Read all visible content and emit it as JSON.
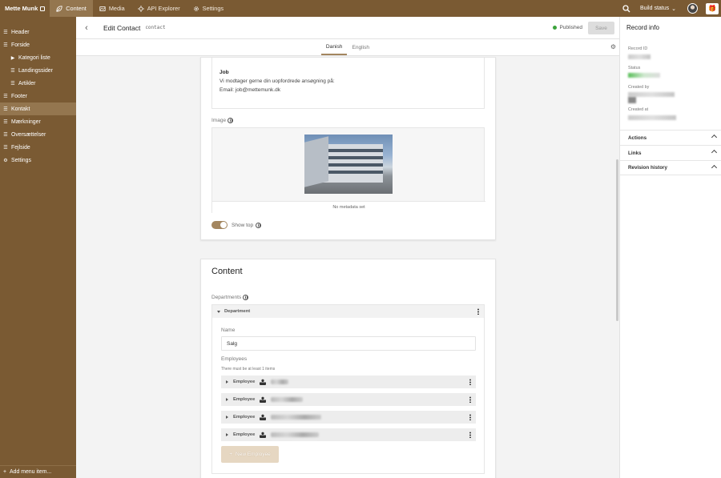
{
  "topbar": {
    "brand": "Mette Munk",
    "tabs": [
      {
        "label": "Content",
        "icon": "leaf-icon",
        "active": true
      },
      {
        "label": "Media",
        "icon": "image-icon",
        "active": false
      },
      {
        "label": "API Explorer",
        "icon": "api-icon",
        "active": false
      },
      {
        "label": "Settings",
        "icon": "gear-icon",
        "active": false
      }
    ],
    "build_status": "Build status"
  },
  "sidebar": {
    "items": [
      {
        "label": "Header",
        "icon": "menu-icon",
        "level": 0
      },
      {
        "label": "Forside",
        "icon": "menu-icon",
        "level": 0
      },
      {
        "label": "Kategori liste",
        "icon": "caret-right-icon",
        "level": 1
      },
      {
        "label": "Landingssider",
        "icon": "menu-icon",
        "level": 1
      },
      {
        "label": "Artikler",
        "icon": "menu-icon",
        "level": 1
      },
      {
        "label": "Footer",
        "icon": "menu-icon",
        "level": 0
      },
      {
        "label": "Kontakt",
        "icon": "menu-icon",
        "level": 0,
        "active": true
      },
      {
        "label": "Mærkninger",
        "icon": "menu-icon",
        "level": 0
      },
      {
        "label": "Oversættelser",
        "icon": "menu-icon",
        "level": 0
      },
      {
        "label": "Fejlside",
        "icon": "menu-icon",
        "level": 0
      },
      {
        "label": "Settings",
        "icon": "gear-icon",
        "level": 0
      }
    ],
    "add_menu_item": "Add menu item..."
  },
  "editor": {
    "title": "Edit Contact",
    "model": "contact",
    "status": "Published",
    "save_label": "Save",
    "languages": [
      {
        "label": "Danish",
        "active": true
      },
      {
        "label": "English",
        "active": false
      }
    ]
  },
  "form": {
    "job_heading": "Job",
    "job_line1": "Vi modtager gerne din uopfordrede ansøgning på:",
    "job_line2": "Email: job@mettemunk.dk",
    "image_label": "Image",
    "image_meta": "No metadata set",
    "show_top_label": "Show top",
    "show_top_value": true,
    "content_title": "Content",
    "departments_label": "Departments",
    "department_label": "Department",
    "name_label": "Name",
    "name_value": "Salg",
    "employees_label": "Employees",
    "employees_hint": "There must be at least 1 items",
    "employees": [
      {
        "label": "Employee"
      },
      {
        "label": "Employee"
      },
      {
        "label": "Employee"
      },
      {
        "label": "Employee"
      }
    ],
    "new_employee": "New Employee"
  },
  "record_info": {
    "title": "Record info",
    "record_id_label": "Record ID",
    "status_label": "Status",
    "created_by_label": "Created by",
    "created_at_label": "Created at",
    "sections": [
      "Actions",
      "Links",
      "Revision history"
    ]
  },
  "colors": {
    "brand": "#7a5a33",
    "brand_active": "#94764f",
    "accent": "#a3865f",
    "published": "#3ca33c"
  }
}
